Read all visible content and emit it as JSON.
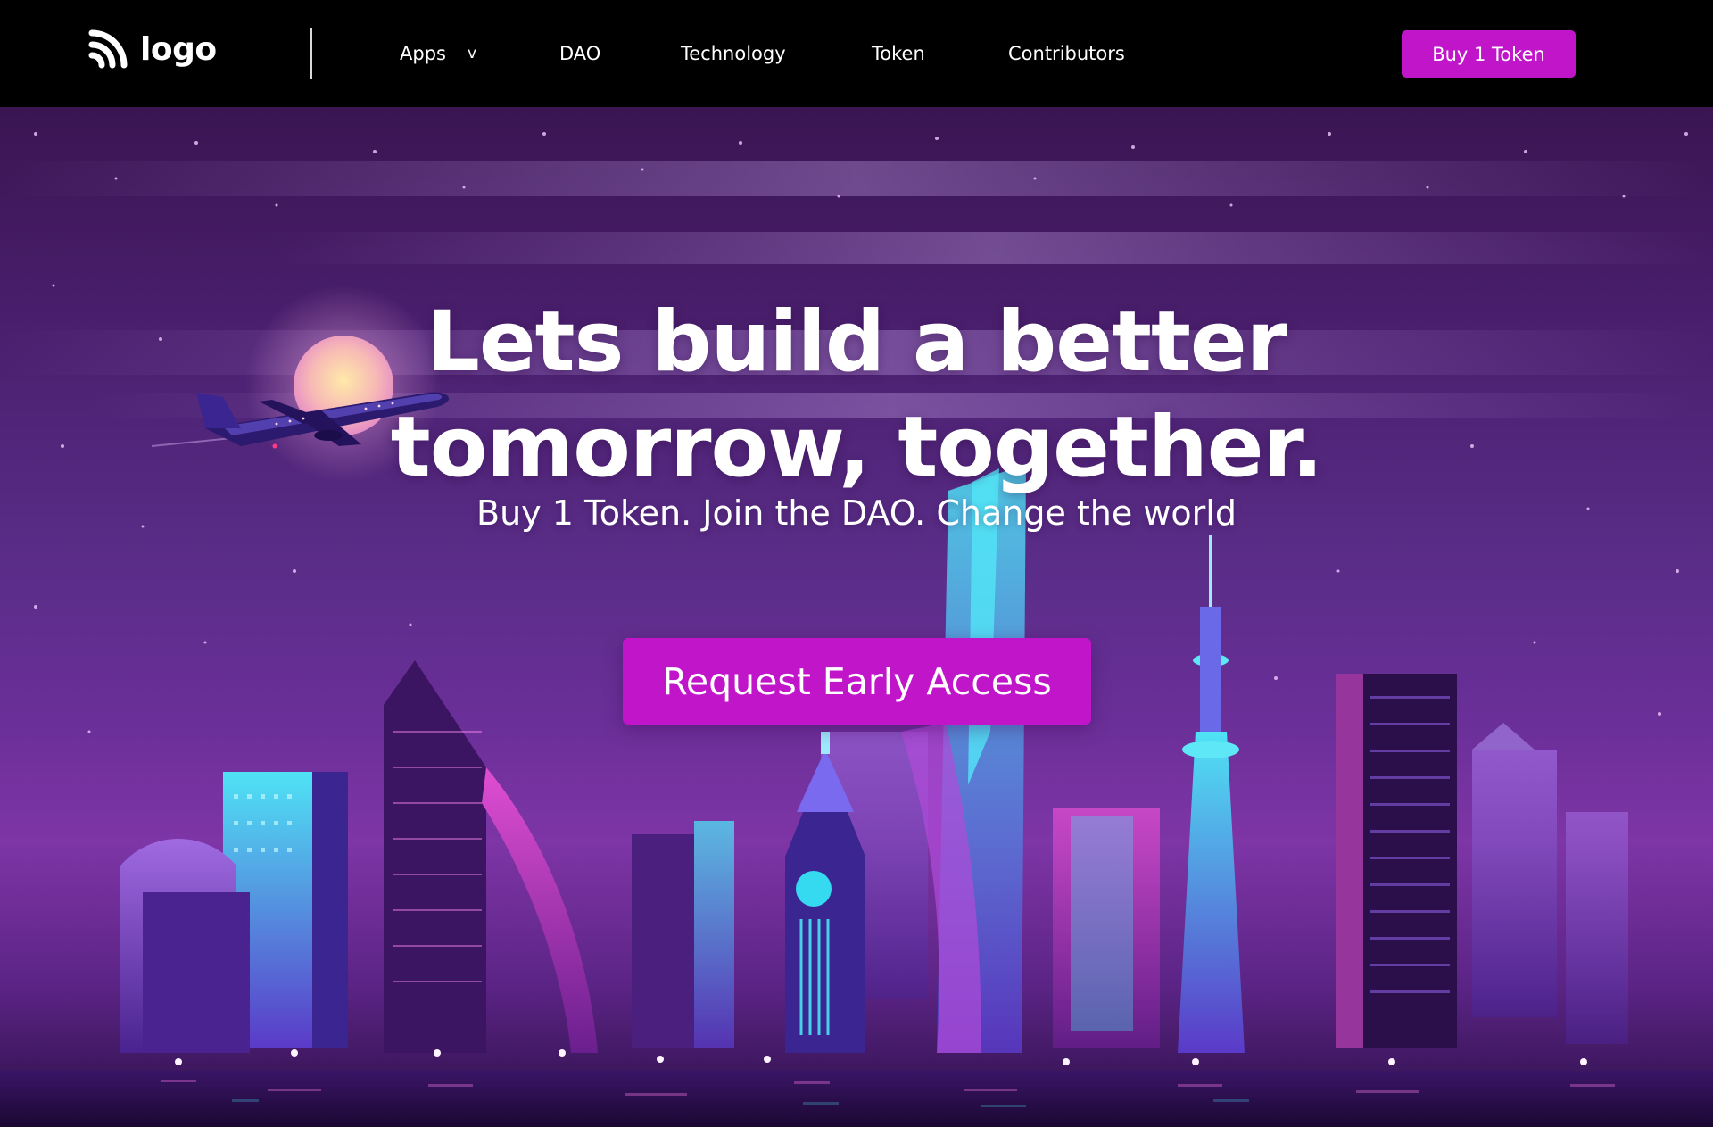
{
  "nav": {
    "logo_text": "logo",
    "links": [
      {
        "label": "Apps",
        "chevron": "v"
      },
      {
        "label": "DAO"
      },
      {
        "label": "Technology"
      },
      {
        "label": "Token"
      },
      {
        "label": "Contributors"
      }
    ],
    "buy_button": "Buy 1 Token"
  },
  "hero": {
    "title_line1": "Lets build a better",
    "title_line2": "tomorrow, together.",
    "subtitle": "Buy 1 Token. Join the DAO. Change the world",
    "cta_button": "Request Early Access",
    "background_image": "neon-city-skyline-illustration"
  },
  "colors": {
    "accent": "#c015c9",
    "navbar_bg": "#000000",
    "hero_sky_top": "#3a1552",
    "hero_sky_mid": "#6a2f98",
    "neon_cyan": "#35d9f0",
    "neon_pink": "#ff4fd8"
  },
  "icons": {
    "logo": "rss-feed-icon",
    "apps_dropdown": "chevron-down-icon"
  }
}
